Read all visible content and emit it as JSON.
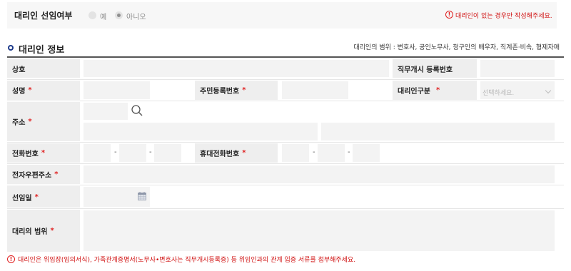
{
  "agent_selection": {
    "question": "대리인 선임여부",
    "options": [
      {
        "label": "예",
        "checked": false
      },
      {
        "label": "아니오",
        "checked": true
      }
    ],
    "note": "대리인이 있는 경우만 작성해주세요."
  },
  "section": {
    "title": "대리인 정보",
    "scope_note": "대리인의 범위 : 변호사, 공인노무사, 청구인의 배우자, 직계존·비속, 형제자매"
  },
  "form": {
    "trade_name": "상호",
    "registration_no": "직무개시 등록번호",
    "name": "성명",
    "resident_no": "주민등록번호",
    "agent_type": "대리인구분",
    "agent_type_placeholder": "선택하세요.",
    "address": "주소",
    "phone": "전화번호",
    "mobile": "휴대전화번호",
    "email": "전자우편주소",
    "appointment_date": "선임일",
    "agent_scope": "대리의 범위",
    "required_mark": "*",
    "dash": "-"
  },
  "footer_note": "대리인은 위임장(임의서식), 가족관계증명서(노무사•변호사는 직무개시등록증) 등 위임인과의 관계 입증 서류를 첨부해주세요.",
  "colors": {
    "required": "#e02020",
    "note": "#d01010",
    "accent": "#1d3a8a"
  },
  "icons": [
    "warning-icon",
    "search-icon",
    "calendar-icon",
    "chevron-down-icon",
    "section-bullet-icon"
  ]
}
